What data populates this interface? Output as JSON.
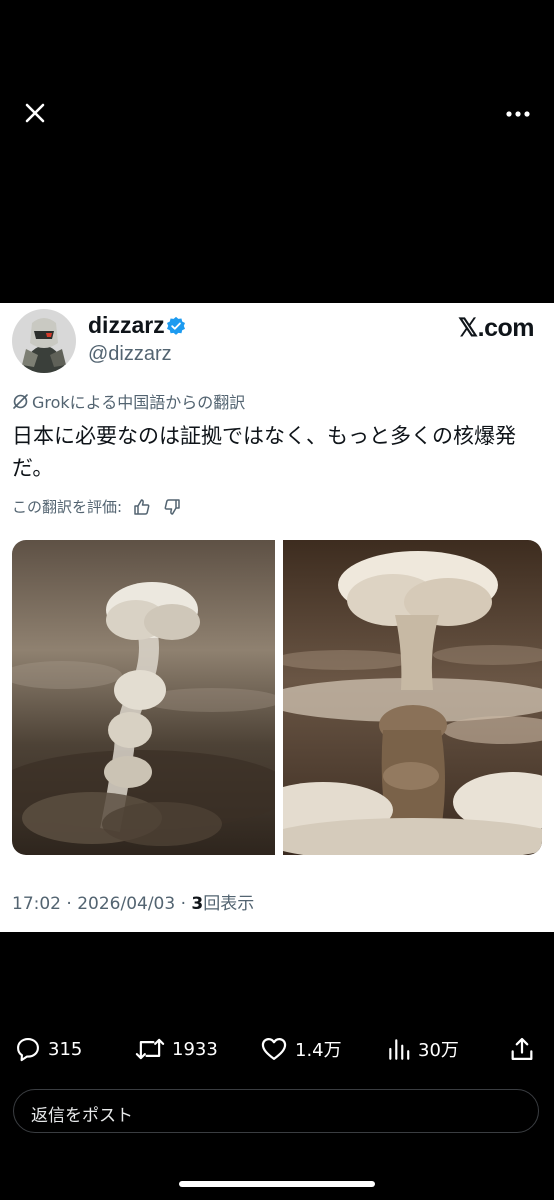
{
  "header": {
    "close_icon": "close-icon",
    "more_icon": "more-horizontal-icon"
  },
  "post": {
    "display_name": "dizzarz",
    "handle": "@dizzarz",
    "verified": true,
    "site_brand": "𝕏.com",
    "translation_label": "Grokによる中国語からの翻訳",
    "text": "日本に必要なのは証拠ではなく、もっと多くの核爆発だ。",
    "rate_label": "この翻訳を評価:",
    "timestamp": "17:02 · 2026/04/03 · ",
    "views_count": "3",
    "views_label": "回表示",
    "images": [
      {
        "name": "mushroom-cloud-photo-left"
      },
      {
        "name": "mushroom-cloud-photo-right"
      }
    ]
  },
  "actions": {
    "replies": "315",
    "reposts": "1933",
    "likes": "1.4万",
    "views": "30万"
  },
  "reply_box": {
    "placeholder": "返信をポスト"
  },
  "colors": {
    "verified": "#1d9bf0",
    "secondary_text": "#536471",
    "primary_text": "#0f1419"
  }
}
